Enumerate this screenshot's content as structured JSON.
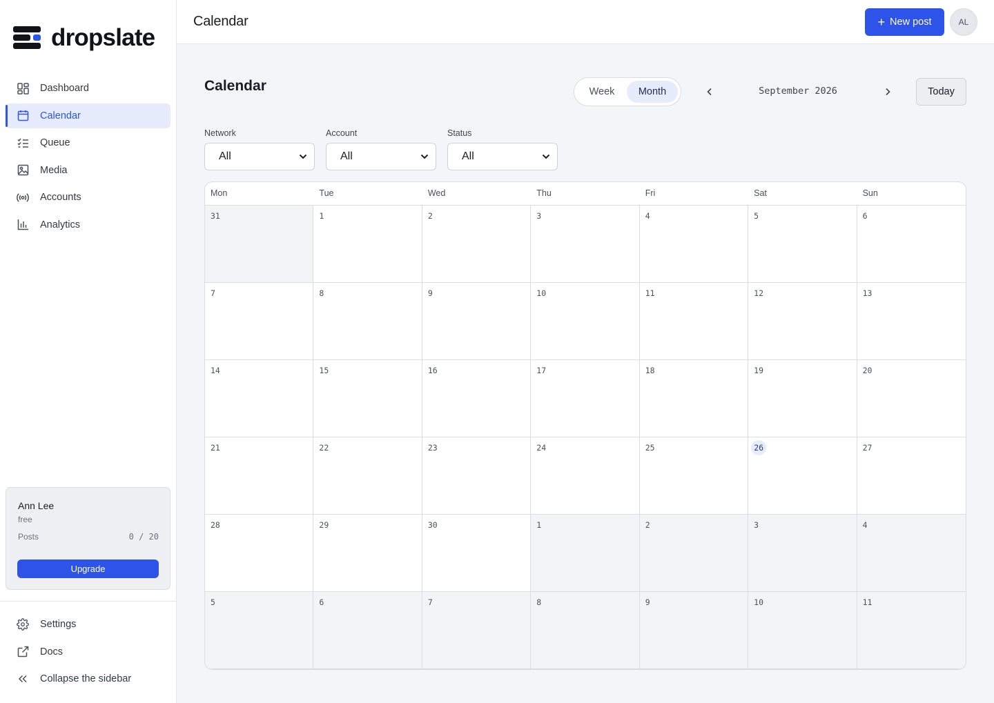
{
  "brand": {
    "name": "dropslate",
    "accent": "#2d53e8"
  },
  "sidebar": {
    "items": [
      {
        "label": "Dashboard",
        "icon": "dashboard-icon"
      },
      {
        "label": "Calendar",
        "icon": "calendar-icon",
        "active": true
      },
      {
        "label": "Queue",
        "icon": "queue-icon"
      },
      {
        "label": "Media",
        "icon": "image-icon"
      },
      {
        "label": "Accounts",
        "icon": "broadcast-icon"
      },
      {
        "label": "Analytics",
        "icon": "bar-chart-icon"
      }
    ],
    "plan": {
      "user": "Ann Lee",
      "tier": "free",
      "posts_label": "Posts",
      "posts_count": "0 / 20",
      "upgrade_label": "Upgrade"
    },
    "bottom": [
      {
        "label": "Settings",
        "icon": "gear-icon"
      },
      {
        "label": "Docs",
        "icon": "external-link-icon"
      },
      {
        "label": "Collapse the sidebar",
        "icon": "chevrons-left-icon"
      }
    ]
  },
  "topbar": {
    "title": "Calendar",
    "new_post_label": "New post",
    "avatar_initials": "AL"
  },
  "main": {
    "title": "Calendar",
    "views": [
      "Week",
      "Month"
    ],
    "active_view": "Month",
    "month_label": "September 2026",
    "today_label": "Today",
    "filters": [
      {
        "label": "Network",
        "value": "All"
      },
      {
        "label": "Account",
        "value": "All"
      },
      {
        "label": "Status",
        "value": "All"
      }
    ]
  },
  "calendar": {
    "weekdays": [
      "Mon",
      "Tue",
      "Wed",
      "Thu",
      "Fri",
      "Sat",
      "Sun"
    ],
    "today": "26",
    "days": [
      {
        "d": "31",
        "other": true
      },
      {
        "d": "1"
      },
      {
        "d": "2"
      },
      {
        "d": "3"
      },
      {
        "d": "4"
      },
      {
        "d": "5"
      },
      {
        "d": "6"
      },
      {
        "d": "7"
      },
      {
        "d": "8"
      },
      {
        "d": "9"
      },
      {
        "d": "10"
      },
      {
        "d": "11"
      },
      {
        "d": "12"
      },
      {
        "d": "13"
      },
      {
        "d": "14"
      },
      {
        "d": "15"
      },
      {
        "d": "16"
      },
      {
        "d": "17"
      },
      {
        "d": "18"
      },
      {
        "d": "19"
      },
      {
        "d": "20"
      },
      {
        "d": "21"
      },
      {
        "d": "22"
      },
      {
        "d": "23"
      },
      {
        "d": "24"
      },
      {
        "d": "25"
      },
      {
        "d": "26",
        "today": true
      },
      {
        "d": "27"
      },
      {
        "d": "28"
      },
      {
        "d": "29"
      },
      {
        "d": "30"
      },
      {
        "d": "1",
        "other": true
      },
      {
        "d": "2",
        "other": true
      },
      {
        "d": "3",
        "other": true
      },
      {
        "d": "4",
        "other": true
      },
      {
        "d": "5",
        "other": true
      },
      {
        "d": "6",
        "other": true
      },
      {
        "d": "7",
        "other": true
      },
      {
        "d": "8",
        "other": true
      },
      {
        "d": "9",
        "other": true
      },
      {
        "d": "10",
        "other": true
      },
      {
        "d": "11",
        "other": true
      }
    ]
  }
}
